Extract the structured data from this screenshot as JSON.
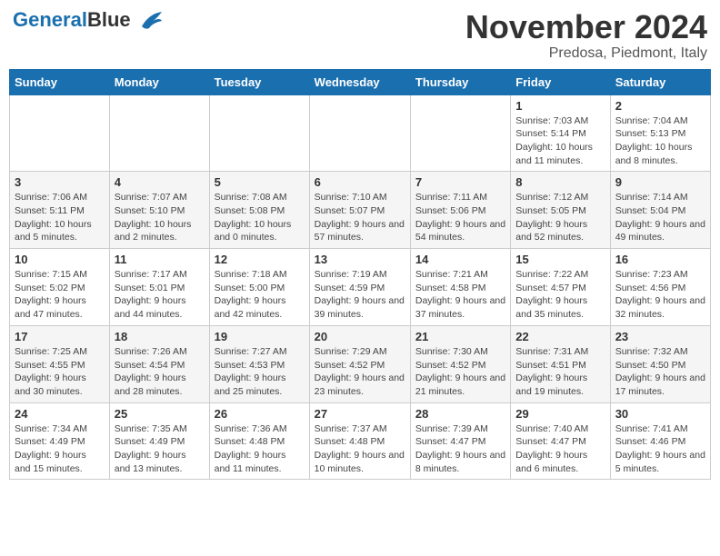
{
  "logo": {
    "text_general": "General",
    "text_blue": "Blue"
  },
  "title": "November 2024",
  "subtitle": "Predosa, Piedmont, Italy",
  "days_of_week": [
    "Sunday",
    "Monday",
    "Tuesday",
    "Wednesday",
    "Thursday",
    "Friday",
    "Saturday"
  ],
  "weeks": [
    [
      {
        "day": "",
        "info": ""
      },
      {
        "day": "",
        "info": ""
      },
      {
        "day": "",
        "info": ""
      },
      {
        "day": "",
        "info": ""
      },
      {
        "day": "",
        "info": ""
      },
      {
        "day": "1",
        "info": "Sunrise: 7:03 AM\nSunset: 5:14 PM\nDaylight: 10 hours and 11 minutes."
      },
      {
        "day": "2",
        "info": "Sunrise: 7:04 AM\nSunset: 5:13 PM\nDaylight: 10 hours and 8 minutes."
      }
    ],
    [
      {
        "day": "3",
        "info": "Sunrise: 7:06 AM\nSunset: 5:11 PM\nDaylight: 10 hours and 5 minutes."
      },
      {
        "day": "4",
        "info": "Sunrise: 7:07 AM\nSunset: 5:10 PM\nDaylight: 10 hours and 2 minutes."
      },
      {
        "day": "5",
        "info": "Sunrise: 7:08 AM\nSunset: 5:08 PM\nDaylight: 10 hours and 0 minutes."
      },
      {
        "day": "6",
        "info": "Sunrise: 7:10 AM\nSunset: 5:07 PM\nDaylight: 9 hours and 57 minutes."
      },
      {
        "day": "7",
        "info": "Sunrise: 7:11 AM\nSunset: 5:06 PM\nDaylight: 9 hours and 54 minutes."
      },
      {
        "day": "8",
        "info": "Sunrise: 7:12 AM\nSunset: 5:05 PM\nDaylight: 9 hours and 52 minutes."
      },
      {
        "day": "9",
        "info": "Sunrise: 7:14 AM\nSunset: 5:04 PM\nDaylight: 9 hours and 49 minutes."
      }
    ],
    [
      {
        "day": "10",
        "info": "Sunrise: 7:15 AM\nSunset: 5:02 PM\nDaylight: 9 hours and 47 minutes."
      },
      {
        "day": "11",
        "info": "Sunrise: 7:17 AM\nSunset: 5:01 PM\nDaylight: 9 hours and 44 minutes."
      },
      {
        "day": "12",
        "info": "Sunrise: 7:18 AM\nSunset: 5:00 PM\nDaylight: 9 hours and 42 minutes."
      },
      {
        "day": "13",
        "info": "Sunrise: 7:19 AM\nSunset: 4:59 PM\nDaylight: 9 hours and 39 minutes."
      },
      {
        "day": "14",
        "info": "Sunrise: 7:21 AM\nSunset: 4:58 PM\nDaylight: 9 hours and 37 minutes."
      },
      {
        "day": "15",
        "info": "Sunrise: 7:22 AM\nSunset: 4:57 PM\nDaylight: 9 hours and 35 minutes."
      },
      {
        "day": "16",
        "info": "Sunrise: 7:23 AM\nSunset: 4:56 PM\nDaylight: 9 hours and 32 minutes."
      }
    ],
    [
      {
        "day": "17",
        "info": "Sunrise: 7:25 AM\nSunset: 4:55 PM\nDaylight: 9 hours and 30 minutes."
      },
      {
        "day": "18",
        "info": "Sunrise: 7:26 AM\nSunset: 4:54 PM\nDaylight: 9 hours and 28 minutes."
      },
      {
        "day": "19",
        "info": "Sunrise: 7:27 AM\nSunset: 4:53 PM\nDaylight: 9 hours and 25 minutes."
      },
      {
        "day": "20",
        "info": "Sunrise: 7:29 AM\nSunset: 4:52 PM\nDaylight: 9 hours and 23 minutes."
      },
      {
        "day": "21",
        "info": "Sunrise: 7:30 AM\nSunset: 4:52 PM\nDaylight: 9 hours and 21 minutes."
      },
      {
        "day": "22",
        "info": "Sunrise: 7:31 AM\nSunset: 4:51 PM\nDaylight: 9 hours and 19 minutes."
      },
      {
        "day": "23",
        "info": "Sunrise: 7:32 AM\nSunset: 4:50 PM\nDaylight: 9 hours and 17 minutes."
      }
    ],
    [
      {
        "day": "24",
        "info": "Sunrise: 7:34 AM\nSunset: 4:49 PM\nDaylight: 9 hours and 15 minutes."
      },
      {
        "day": "25",
        "info": "Sunrise: 7:35 AM\nSunset: 4:49 PM\nDaylight: 9 hours and 13 minutes."
      },
      {
        "day": "26",
        "info": "Sunrise: 7:36 AM\nSunset: 4:48 PM\nDaylight: 9 hours and 11 minutes."
      },
      {
        "day": "27",
        "info": "Sunrise: 7:37 AM\nSunset: 4:48 PM\nDaylight: 9 hours and 10 minutes."
      },
      {
        "day": "28",
        "info": "Sunrise: 7:39 AM\nSunset: 4:47 PM\nDaylight: 9 hours and 8 minutes."
      },
      {
        "day": "29",
        "info": "Sunrise: 7:40 AM\nSunset: 4:47 PM\nDaylight: 9 hours and 6 minutes."
      },
      {
        "day": "30",
        "info": "Sunrise: 7:41 AM\nSunset: 4:46 PM\nDaylight: 9 hours and 5 minutes."
      }
    ]
  ]
}
